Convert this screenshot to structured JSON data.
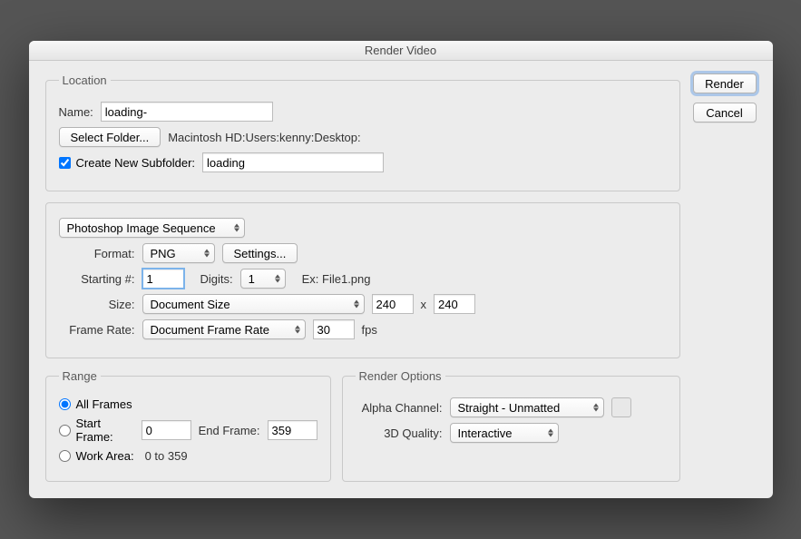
{
  "window": {
    "title": "Render Video"
  },
  "buttons": {
    "render": "Render",
    "cancel": "Cancel"
  },
  "location": {
    "legend": "Location",
    "name_label": "Name:",
    "name_value": "loading-",
    "select_folder": "Select Folder...",
    "path": "Macintosh HD:Users:kenny:Desktop:",
    "subfolder_label": "Create New Subfolder:",
    "subfolder_value": "loading"
  },
  "sequence": {
    "type": "Photoshop Image Sequence",
    "format_label": "Format:",
    "format_value": "PNG",
    "settings": "Settings...",
    "starting_label": "Starting #:",
    "starting_value": "1",
    "digits_label": "Digits:",
    "digits_value": "1",
    "example": "Ex: File1.png",
    "size_label": "Size:",
    "size_value": "Document Size",
    "width": "240",
    "x": "x",
    "height": "240",
    "framerate_label": "Frame Rate:",
    "framerate_value": "Document Frame Rate",
    "fps_value": "30",
    "fps_label": "fps"
  },
  "range": {
    "legend": "Range",
    "all_frames": "All Frames",
    "start_frame_label": "Start Frame:",
    "start_frame_value": "0",
    "end_frame_label": "End Frame:",
    "end_frame_value": "359",
    "work_area_label": "Work Area:",
    "work_area_value": "0 to 359"
  },
  "render_options": {
    "legend": "Render Options",
    "alpha_label": "Alpha Channel:",
    "alpha_value": "Straight - Unmatted",
    "quality_label": "3D Quality:",
    "quality_value": "Interactive"
  }
}
